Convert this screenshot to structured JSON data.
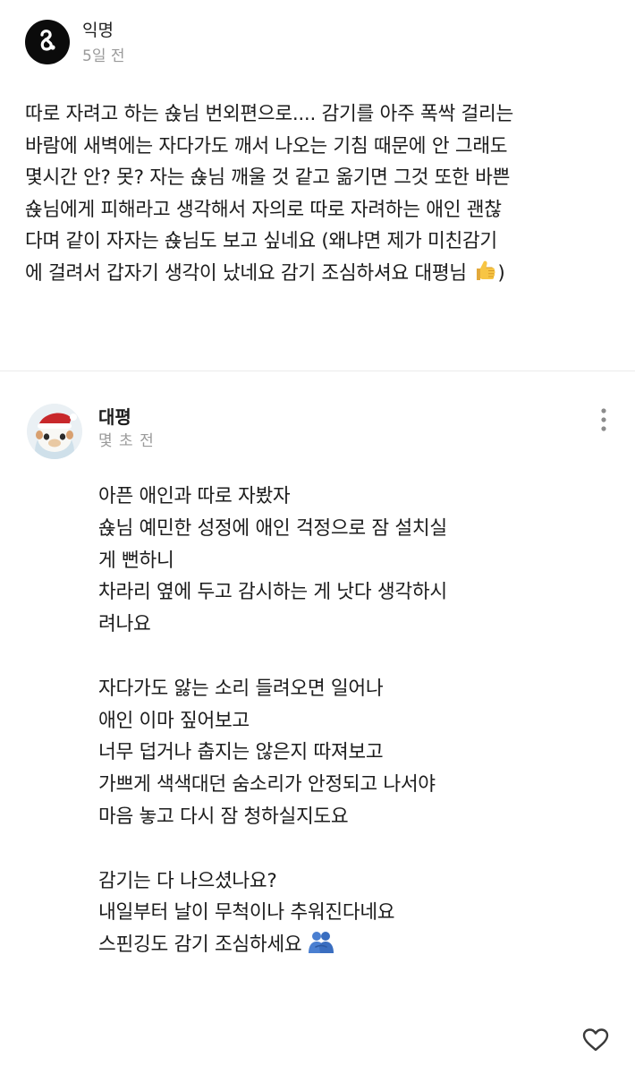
{
  "post": {
    "author": "익명",
    "time": "5일 전",
    "body": "따로 자려고 하는 숁님 번외편으로.... 감기를 아주 폭싹 걸리는\n바람에 새벽에는 자다가도 깨서 나오는 기침 때문에 안 그래도\n몇시간 안? 못? 자는 숁님 깨울 것 같고 옮기면 그것 또한 바쁜\n숁님에게 피해라고 생각해서 자의로 따로 자려하는 애인 괜찮\n다며 같이 자자는 숁님도 보고 싶네요 (왜냐면 제가 미친감기\n에 걸려서 갑자기 생각이 났네요 감기 조심하셔요 대평님",
    "body_end": ")",
    "emoji_icon": "thumbs-up-icon",
    "avatar_icon": "anonymous-logo-icon"
  },
  "comment": {
    "author": "대평",
    "time": "몇 초 전",
    "body": "아픈 애인과 따로 자봤자\n숁님 예민한 성정에 애인 걱정으로 잠 설치실\n게 뻔하니\n차라리 옆에 두고 감시하는 게 낫다 생각하시\n려나요\n\n자다가도 앓는 소리 들려오면 일어나\n애인 이마 짚어보고\n너무 덥거나 춥지는 않은지 따져보고\n가쁘게 색색대던 숨소리가 안정되고 나서야\n마음 놓고 다시 잠 청하실지도요\n\n감기는 다 나으셨나요?\n내일부터 날이 무척이나 추워진다네요\n스핀깅도 감기 조심하세요",
    "emoji_icon": "people-hugging-icon",
    "avatar_icon": "avatar-santa-hat-icon",
    "more_icon": "vertical-dots-icon",
    "like_icon": "heart-outline-icon"
  },
  "colors": {
    "muted_text": "#9a9a9a",
    "divider": "#ebebeb",
    "emoji_yellow": "#f7c544",
    "emoji_blue": "#4a7fd1"
  }
}
